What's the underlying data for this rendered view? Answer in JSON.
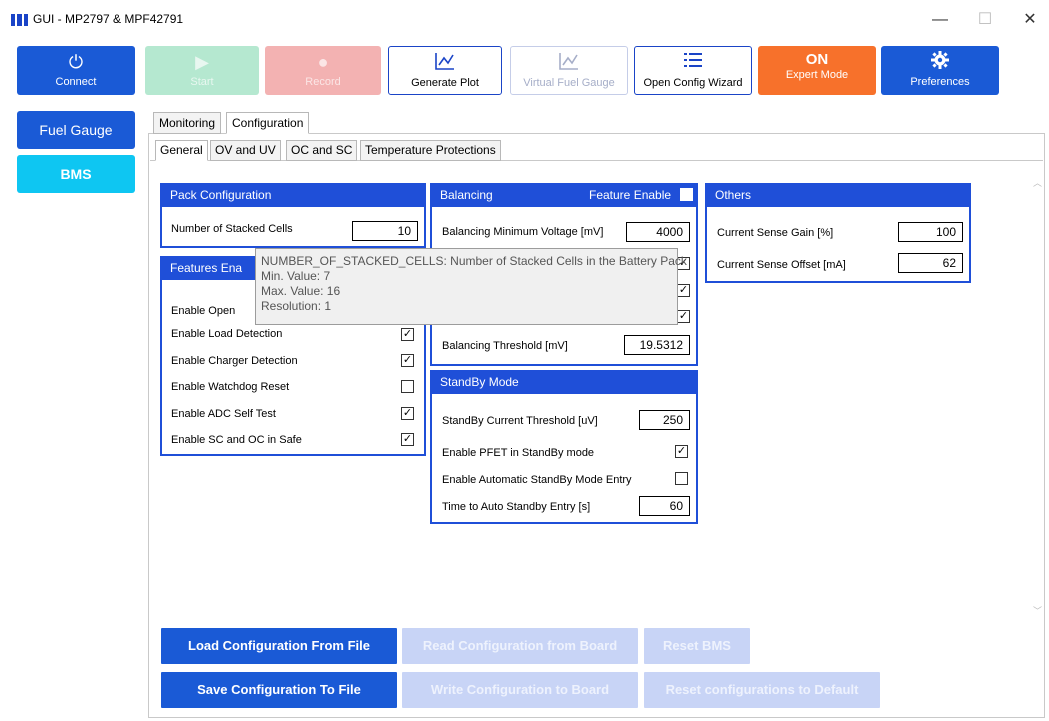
{
  "window": {
    "title": "GUI - MP2797 & MPF42791",
    "minimize": "—",
    "maximize": "☐",
    "close": "✕"
  },
  "toolbar": {
    "connect": "Connect",
    "start": "Start",
    "record": "Record",
    "generate_plot": "Generate Plot",
    "virtual_fuel_gauge": "Virtual Fuel Gauge",
    "open_config_wizard": "Open Config Wizard",
    "expert_mode_state": "ON",
    "expert_mode": "Expert Mode",
    "preferences": "Preferences"
  },
  "nav": {
    "fuel_gauge": "Fuel Gauge",
    "bms": "BMS"
  },
  "tabs": {
    "monitoring": "Monitoring",
    "configuration": "Configuration"
  },
  "subtabs": {
    "general": "General",
    "ov_uv": "OV and UV",
    "oc_sc": "OC and SC",
    "temp": "Temperature Protections"
  },
  "pack": {
    "title": "Pack Configuration",
    "stacked_cells_label": "Number of Stacked Cells",
    "stacked_cells_value": "10"
  },
  "features": {
    "title": "Features Ena",
    "enable_open": "Enable Open",
    "load_detection": "Enable Load Detection",
    "charger_detection": "Enable Charger Detection",
    "watchdog_reset": "Enable Watchdog Reset",
    "adc_self_test": "Enable ADC Self Test",
    "sc_oc_safe": "Enable SC and OC in Safe",
    "check": "✓"
  },
  "balancing": {
    "title": "Balancing",
    "feature_enable": "Feature Enable",
    "min_voltage_label": "Balancing Minimum Voltage [mV]",
    "min_voltage_value": "4000",
    "threshold_label": "Balancing Threshold [mV]",
    "threshold_value": "19.5312"
  },
  "standby": {
    "title": "StandBy Mode",
    "current_threshold_label": "StandBy Current Threshold [uV]",
    "current_threshold_value": "250",
    "enable_pfet_label": "Enable PFET in StandBy mode",
    "auto_entry_label": "Enable Automatic StandBy Mode Entry",
    "time_auto_label": "Time to Auto Standby Entry [s]",
    "time_auto_value": "60"
  },
  "others": {
    "title": "Others",
    "gain_label": "Current Sense Gain [%]",
    "gain_value": "100",
    "offset_label": "Current Sense Offset [mA]",
    "offset_value": "62"
  },
  "tooltip": {
    "line1": "NUMBER_OF_STACKED_CELLS: Number of Stacked Cells in the Battery Pack",
    "line2": "Min. Value: 7",
    "line3": "Max. Value: 16",
    "line4": "Resolution: 1"
  },
  "actions": {
    "load_file": "Load Configuration From File",
    "read_board": "Read Configuration from Board",
    "reset_bms": "Reset BMS",
    "save_file": "Save Configuration To File",
    "write_board": "Write Configuration to Board",
    "reset_default": "Reset configurations to Default"
  },
  "colors": {
    "accent": "#1f4fd8",
    "expert": "#f7712b",
    "bms": "#0ec6f2"
  }
}
